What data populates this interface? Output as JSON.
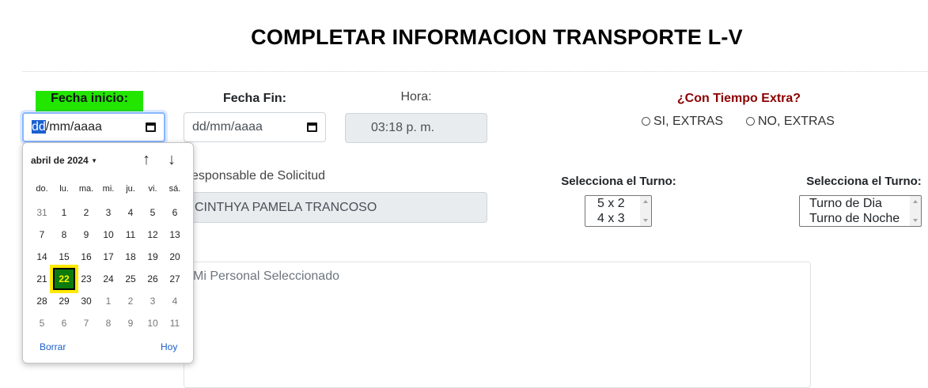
{
  "page": {
    "title": "COMPLETAR INFORMACION TRANSPORTE L-V"
  },
  "form": {
    "fecha_inicio": {
      "label": "Fecha inicio:",
      "value_dd": "dd",
      "value_rest": "/mm/aaaa"
    },
    "fecha_fin": {
      "label": "Fecha Fin:",
      "value": "dd/mm/aaaa"
    },
    "hora": {
      "label": "Hora:",
      "value": "03:18 p. m."
    },
    "tiempo_extra": {
      "label": "¿Con Tiempo Extra?",
      "options": [
        "SI, EXTRAS",
        "NO, EXTRAS"
      ]
    },
    "responsable": {
      "label": "esponsable de Solicitud",
      "value": "CINTHYA PAMELA TRANCOSO"
    },
    "turno1": {
      "label": "Selecciona el Turno:",
      "options": [
        "5 x 2",
        "4 x 3"
      ]
    },
    "turno2": {
      "label": "Selecciona el Turno:",
      "options": [
        "Turno de Dia",
        "Turno de Noche"
      ]
    },
    "personal": {
      "placeholder": "Mi Personal Seleccionado"
    }
  },
  "calendar": {
    "month": "abril de 2024",
    "weekdays": [
      "do.",
      "lu.",
      "ma.",
      "mi.",
      "ju.",
      "vi.",
      "sá."
    ],
    "weeks": [
      [
        "31",
        "1",
        "2",
        "3",
        "4",
        "5",
        "6"
      ],
      [
        "7",
        "8",
        "9",
        "10",
        "11",
        "12",
        "13"
      ],
      [
        "14",
        "15",
        "16",
        "17",
        "18",
        "19",
        "20"
      ],
      [
        "21",
        "22",
        "23",
        "24",
        "25",
        "26",
        "27"
      ],
      [
        "28",
        "29",
        "30",
        "1",
        "2",
        "3",
        "4"
      ],
      [
        "5",
        "6",
        "7",
        "8",
        "9",
        "10",
        "11"
      ]
    ],
    "selected": "22",
    "clear_label": "Borrar",
    "today_label": "Hoy"
  },
  "colors": {
    "highlight_label_bg": "#22e600",
    "extra_label": "#8b0000",
    "selected_day_bg": "#0c7a0c",
    "selected_day_outline": "#ffe900"
  }
}
